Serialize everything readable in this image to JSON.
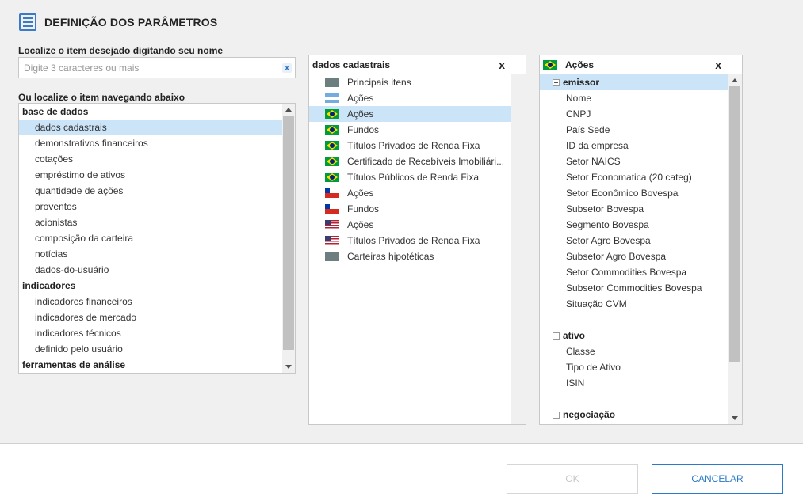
{
  "header": {
    "title": "DEFINIÇÃO DOS PARÂMETROS",
    "icon": "list-icon"
  },
  "search": {
    "label": "Localize o item desejado digitando seu nome",
    "placeholder": "Digite 3 caracteres ou mais",
    "value": "",
    "clear_label": "x"
  },
  "navigate_label": "Ou localize o item navegando abaixo",
  "left_tree": [
    {
      "type": "group",
      "label": "base de dados"
    },
    {
      "type": "item",
      "label": "dados cadastrais",
      "selected": true
    },
    {
      "type": "item",
      "label": "demonstrativos financeiros"
    },
    {
      "type": "item",
      "label": "cotações"
    },
    {
      "type": "item",
      "label": "empréstimo de ativos"
    },
    {
      "type": "item",
      "label": "quantidade de ações"
    },
    {
      "type": "item",
      "label": "proventos"
    },
    {
      "type": "item",
      "label": "acionistas"
    },
    {
      "type": "item",
      "label": "composição da carteira"
    },
    {
      "type": "item",
      "label": "notícias"
    },
    {
      "type": "item",
      "label": "dados-do-usuário"
    },
    {
      "type": "group",
      "label": "indicadores"
    },
    {
      "type": "item",
      "label": "indicadores financeiros"
    },
    {
      "type": "item",
      "label": "indicadores de mercado"
    },
    {
      "type": "item",
      "label": "indicadores técnicos"
    },
    {
      "type": "item",
      "label": "definido pelo usuário"
    },
    {
      "type": "group",
      "label": "ferramentas de análise"
    }
  ],
  "middle_panel": {
    "title": "dados cadastrais",
    "close_label": "x",
    "items": [
      {
        "flag": "gray",
        "label": "Principais itens"
      },
      {
        "flag": "ar",
        "label": "Ações"
      },
      {
        "flag": "br",
        "label": "Ações",
        "selected": true
      },
      {
        "flag": "br",
        "label": "Fundos"
      },
      {
        "flag": "br",
        "label": "Títulos Privados de Renda Fixa"
      },
      {
        "flag": "br",
        "label": "Certificado de Recebíveis Imobiliári..."
      },
      {
        "flag": "br",
        "label": "Títulos Públicos de Renda Fixa"
      },
      {
        "flag": "cl",
        "label": "Ações"
      },
      {
        "flag": "cl",
        "label": "Fundos"
      },
      {
        "flag": "us",
        "label": "Ações"
      },
      {
        "flag": "us",
        "label": "Títulos Privados de Renda Fixa"
      },
      {
        "flag": "gray",
        "label": "Carteiras hipotéticas"
      }
    ]
  },
  "right_panel": {
    "title": "Ações",
    "title_flag": "br",
    "close_label": "x",
    "groups": [
      {
        "label": "emissor",
        "selected": true,
        "items": [
          "Nome",
          "CNPJ",
          "País Sede",
          "ID da empresa",
          "Setor NAICS",
          "Setor Economatica (20 categ)",
          "Setor Econômico Bovespa",
          "Subsetor Bovespa",
          "Segmento Bovespa",
          "Setor Agro Bovespa",
          "Subsetor Agro Bovespa",
          "Setor Commodities Bovespa",
          "Subsetor Commodities Bovespa",
          "Situação CVM"
        ]
      },
      {
        "label": "ativo",
        "items": [
          "Classe",
          "Tipo de Ativo",
          "ISIN"
        ]
      },
      {
        "label": "negociação",
        "items": []
      }
    ]
  },
  "buttons": {
    "ok": "OK",
    "cancel": "CANCELAR"
  },
  "colors": {
    "accent": "#2a7ac8",
    "selection": "#cce4f7"
  }
}
